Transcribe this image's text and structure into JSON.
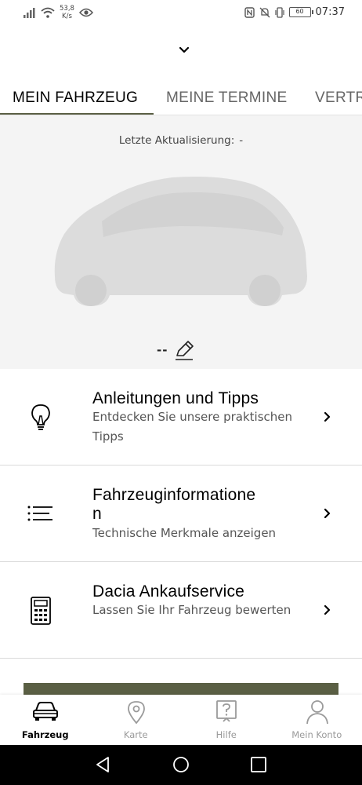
{
  "status_bar": {
    "net_speed_value": "53,8",
    "net_speed_unit": "K/s",
    "battery": "60",
    "time": "07:37"
  },
  "tabs": [
    {
      "label": "MEIN FAHRZEUG",
      "active": true
    },
    {
      "label": "MEINE TERMINE",
      "active": false
    },
    {
      "label": "VERTR",
      "active": false
    }
  ],
  "vehicle": {
    "last_update_label": "Letzte Aktualisierung:",
    "last_update_value": "-",
    "plate": "--"
  },
  "menu_items": [
    {
      "title": "Anleitungen und Tipps",
      "subtitle": "Entdecken Sie unsere praktischen Tipps",
      "icon": "lightbulb-icon"
    },
    {
      "title_line1": "Fahrzeuginformatione",
      "title_line2": "n",
      "subtitle": "Technische Merkmale anzeigen",
      "icon": "list-icon"
    },
    {
      "title": "Dacia Ankaufservice",
      "subtitle": "Lassen Sie Ihr Fahrzeug bewerten",
      "icon": "calculator-icon"
    }
  ],
  "bottom_nav": [
    {
      "label": "Fahrzeug",
      "icon": "car-icon",
      "active": true
    },
    {
      "label": "Karte",
      "icon": "map-pin-icon",
      "active": false
    },
    {
      "label": "Hilfe",
      "icon": "help-icon",
      "active": false
    },
    {
      "label": "Mein Konto",
      "icon": "user-icon",
      "active": false
    }
  ],
  "colors": {
    "accent": "#5a5f44",
    "background": "#ffffff",
    "hero_background": "#f4f4f4"
  }
}
